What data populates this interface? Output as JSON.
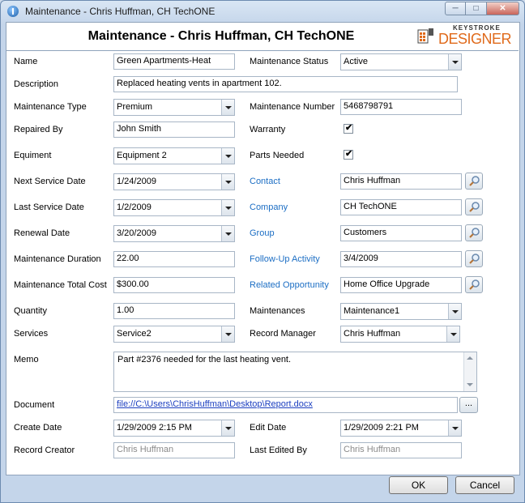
{
  "window": {
    "title": "Maintenance - Chris Huffman, CH TechONE",
    "min_glyph": "─",
    "max_glyph": "□",
    "close_glyph": "✕"
  },
  "header": {
    "title": "Maintenance - Chris Huffman, CH TechONE",
    "logo_small": "KEYSTROKE",
    "logo_big": "DESIGNER"
  },
  "form": {
    "name": {
      "label": "Name",
      "value": "Green Apartments-Heat"
    },
    "maintenance_status": {
      "label": "Maintenance Status",
      "value": "Active"
    },
    "description": {
      "label": "Description",
      "value": "Replaced heating vents in apartment 102."
    },
    "maintenance_type": {
      "label": "Maintenance Type",
      "value": "Premium"
    },
    "maintenance_number": {
      "label": "Maintenance Number",
      "value": "5468798791"
    },
    "repaired_by": {
      "label": "Repaired By",
      "value": "John Smith"
    },
    "warranty": {
      "label": "Warranty",
      "checked": true,
      "mark": "✔"
    },
    "equipment": {
      "label": "Equiment",
      "value": "Equipment 2"
    },
    "parts_needed": {
      "label": "Parts Needed",
      "checked": true,
      "mark": "✔"
    },
    "next_service_date": {
      "label": "Next Service Date",
      "value": "1/24/2009"
    },
    "contact": {
      "label": "Contact",
      "value": "Chris Huffman"
    },
    "last_service_date": {
      "label": "Last Service  Date",
      "value": "1/2/2009"
    },
    "company": {
      "label": "Company",
      "value": "CH TechONE"
    },
    "renewal_date": {
      "label": "Renewal Date",
      "value": "3/20/2009"
    },
    "group": {
      "label": "Group",
      "value": "Customers"
    },
    "maintenance_duration": {
      "label": "Maintenance Duration",
      "value": "22.00"
    },
    "follow_up_activity": {
      "label": "Follow-Up Activity",
      "value": "3/4/2009"
    },
    "maintenance_total_cost": {
      "label": "Maintenance Total Cost",
      "value": "$300.00"
    },
    "related_opportunity": {
      "label": "Related Opportunity",
      "value": "Home Office Upgrade"
    },
    "quantity": {
      "label": "Quantity",
      "value": "1.00"
    },
    "maintenances": {
      "label": "Maintenances",
      "value": "Maintenance1"
    },
    "services": {
      "label": "Services",
      "value": "Service2"
    },
    "record_manager": {
      "label": "Record Manager",
      "value": "Chris Huffman"
    },
    "memo": {
      "label": "Memo",
      "value": "Part #2376 needed for the last heating vent."
    },
    "document": {
      "label": "Document",
      "value": "file://C:\\Users\\ChrisHuffman\\Desktop\\Report.docx",
      "browse": "..."
    },
    "create_date": {
      "label": "Create Date",
      "value": "1/29/2009 2:15 PM"
    },
    "edit_date": {
      "label": "Edit Date",
      "value": "1/29/2009 2:21 PM"
    },
    "record_creator": {
      "label": "Record Creator",
      "value": "Chris Huffman"
    },
    "last_edited_by": {
      "label": "Last Edited By",
      "value": "Chris Huffman"
    }
  },
  "buttons": {
    "ok": "OK",
    "cancel": "Cancel"
  },
  "colors": {
    "link_label": "#1c6ec4",
    "logo_accent": "#e06a1b",
    "window_bg": "#c4d5ea"
  }
}
